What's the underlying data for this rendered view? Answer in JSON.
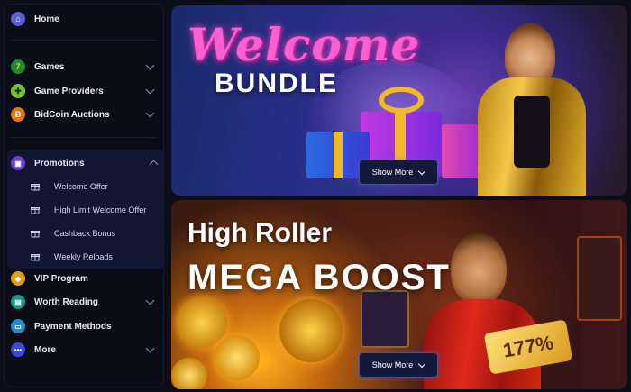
{
  "sidebar": {
    "home": {
      "label": "Home",
      "icon": "home-icon"
    },
    "games": {
      "label": "Games",
      "icon": "seven-icon"
    },
    "providers": {
      "label": "Game Providers",
      "icon": "puzzle-icon"
    },
    "bidcoin": {
      "label": "BidCoin Auctions",
      "icon": "bidcoin-icon"
    },
    "promotions": {
      "label": "Promotions",
      "icon": "gift-icon",
      "items": [
        {
          "label": "Welcome Offer"
        },
        {
          "label": "High Limit Welcome Offer"
        },
        {
          "label": "Cashback Bonus"
        },
        {
          "label": "Weekly Reloads"
        }
      ]
    },
    "vip": {
      "label": "VIP Program",
      "icon": "diamond-icon"
    },
    "reading": {
      "label": "Worth Reading",
      "icon": "book-icon"
    },
    "payment": {
      "label": "Payment Methods",
      "icon": "payment-icon"
    },
    "more": {
      "label": "More",
      "icon": "dots-icon"
    }
  },
  "banners": [
    {
      "title_script": "Welcome",
      "title_bold": "BUNDLE",
      "button": "Show More"
    },
    {
      "title_line1": "High Roller",
      "title_line2": "MEGA  BOOST",
      "badge": "177%",
      "button": "Show More"
    }
  ],
  "colors": {
    "accent": "#ff5fd0",
    "sidebar_bg": "#0a0c18",
    "promo_bg": "#121631"
  }
}
